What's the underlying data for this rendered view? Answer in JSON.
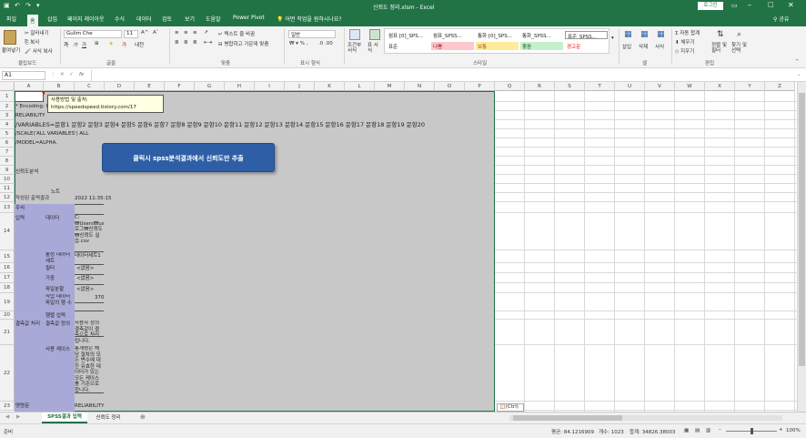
{
  "titlebar": {
    "filename": "신뢰도 정리.xlsm",
    "app": "Excel",
    "login": "로그인",
    "undo": "↶",
    "redo": "↷",
    "save": "💾"
  },
  "tabs": [
    "파일",
    "홈",
    "삽입",
    "페이지 레이아웃",
    "수식",
    "데이터",
    "검토",
    "보기",
    "도움말",
    "Power Pivot"
  ],
  "tell_me": "어떤 작업을 원하시나요?",
  "share": "공유",
  "ribbon": {
    "paste": "붙여넣기",
    "cut": "잘라내기",
    "copy": "복사",
    "format_painter": "서식 복사",
    "clipboard": "클립보드",
    "font_name": "Gulim Che",
    "font_size": "11",
    "font_group": "글꼴",
    "wrap_text": "텍스트 줄 바꿈",
    "merge_center": "병합하고 가운데 맞춤",
    "alignment": "맞춤",
    "number_format": "일반",
    "number": "표시 형식",
    "cond_format": "조건부 서식",
    "table_format": "표 서식",
    "styles": [
      {
        "label": "쉼표 [0]_SPS...",
        "bg": "#ffffff",
        "fg": "#222222"
      },
      {
        "label": "쉼표_SPSS...",
        "bg": "#ffffff",
        "fg": "#222222"
      },
      {
        "label": "통화 [0]_SPS...",
        "bg": "#ffffff",
        "fg": "#222222"
      },
      {
        "label": "통화_SPSS...",
        "bg": "#ffffff",
        "fg": "#222222"
      },
      {
        "label": "표준_SPSS...",
        "bg": "#ffffff",
        "fg": "#222222"
      },
      {
        "label": "표준",
        "bg": "#ffffff",
        "fg": "#222222"
      },
      {
        "label": "나쁨",
        "bg": "#ffc7ce",
        "fg": "#9c0006"
      },
      {
        "label": "보통",
        "bg": "#ffeb9c",
        "fg": "#9c5700"
      },
      {
        "label": "좋음",
        "bg": "#c6efce",
        "fg": "#006100"
      },
      {
        "label": "경고문",
        "bg": "#ffffff",
        "fg": "#ff0000"
      }
    ],
    "style_group": "스타일",
    "insert": "삽입",
    "delete": "삭제",
    "format": "서식",
    "cells": "셀",
    "autosum": "자동 합계",
    "fill": "채우기",
    "clear": "지우기",
    "sort_filter": "정렬 및 필터",
    "find_select": "찾기 및 선택",
    "editing": "편집"
  },
  "formula_bar": {
    "cell_ref": "A1",
    "fx": "fx",
    "value": ""
  },
  "columns": [
    "A",
    "B",
    "C",
    "D",
    "E",
    "F",
    "G",
    "H",
    "I",
    "J",
    "K",
    "L",
    "M",
    "N",
    "O",
    "P",
    "Q",
    "R",
    "S",
    "T",
    "U",
    "V",
    "W",
    "X",
    "Y",
    "Z"
  ],
  "rows": [
    "1",
    "2",
    "3",
    "4",
    "5",
    "6",
    "7",
    "8",
    "9",
    "10",
    "11",
    "12",
    "13",
    "14",
    "15",
    "16",
    "17",
    "18",
    "19",
    "20",
    "21",
    "22",
    "23"
  ],
  "cells": {
    "comment_title": "사용방법 및 출처:",
    "comment_url": "https://speedspeed.tistory.com/17",
    "r2": "* Encoding: UTF-8.",
    "r3": "RELIABILITY",
    "r4": "  /VARIABLES=문항1 문항2 문항3 문항4 문항5 문항6 문항7 문항8 문항9 문항10 문항11 문항12 문항13 문항14 문항15 문항16 문항17 문항18 문항19 문항20",
    "r5": "  /SCALE('ALL VARIABLES') ALL",
    "r6": "  /MODEL=ALPHA.",
    "r9": "신뢰도분석",
    "r11": "노트",
    "r12a": "작성된 출력결과",
    "r12c": "2022 11:35:15",
    "r13a": "주석",
    "r14a": "입력",
    "r14b": "데이터",
    "r14c": "C:₩Users₩user₩Desktop₩블로그₩신뢰도₩신뢰도 실습.csv",
    "r15b": "활성 데이터 세트",
    "r15c": "데이터세트1",
    "r16b": "필터",
    "r16c": "<없음>",
    "r17b": "가중",
    "r17c": "<없음>",
    "r18b": "파일분할",
    "r18c": "<없음>",
    "r19b": "작업 데이터 파일의 행 수",
    "r19c": "370",
    "r20b": "행렬 입력",
    "r21a": "결측값 처리",
    "r21b": "결측값 정의",
    "r21c": "사용자 정의 결측값이 결측으로 처리됩니다.",
    "r22b": "사용 케이스",
    "r22c": "통계량은 해당 절차의 모든 변수에 대한 유효한 데이터가 있는 모든 케이스를 기준으로 합니다.",
    "r23a": "명령문",
    "r23c": "RELIABILITY"
  },
  "button_label": "클릭시 spss분석결과에서 신뢰도만 추출",
  "paste_options": "(Ctrl)",
  "sheet_tabs": [
    "SPSS결과 입력",
    "신뢰도 정리"
  ],
  "status": {
    "ready": "준비",
    "average": "평균: 84.1216909",
    "count": "개수: 1023",
    "sum": "합계: 34826.38003",
    "zoom": "100%"
  },
  "colors": {
    "excel_green": "#217346",
    "button_blue": "#2e5fa6",
    "selection_gray": "#c8c8c8",
    "table_purple": "#a9a9d8"
  }
}
